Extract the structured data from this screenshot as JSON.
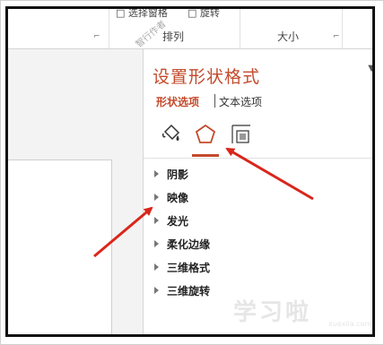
{
  "ribbon": {
    "cut_text_left": "□ 选择窗格",
    "cut_text_right": "□ 旋转",
    "group_arrange": "排列",
    "group_size": "大小",
    "launcher_glyph": "⌐",
    "watermark": "智行作者"
  },
  "panel": {
    "title": "设置形状格式",
    "menu_glyph": "▼",
    "tabs": [
      {
        "label": "形状选项",
        "active": true
      },
      {
        "label": "文本选项",
        "active": false
      }
    ],
    "icons": [
      "fill-line-icon",
      "effects-pentagon-icon",
      "size-properties-icon"
    ],
    "sections": [
      {
        "label": "阴影"
      },
      {
        "label": "映像"
      },
      {
        "label": "发光"
      },
      {
        "label": "柔化边缘"
      },
      {
        "label": "三维格式"
      },
      {
        "label": "三维旋转"
      }
    ],
    "watermark": "学习啦",
    "watermark_sub": "xuexila.com"
  },
  "colors": {
    "accent": "#c44a2c",
    "arrow": "#d9261c",
    "frame": "#111111"
  }
}
